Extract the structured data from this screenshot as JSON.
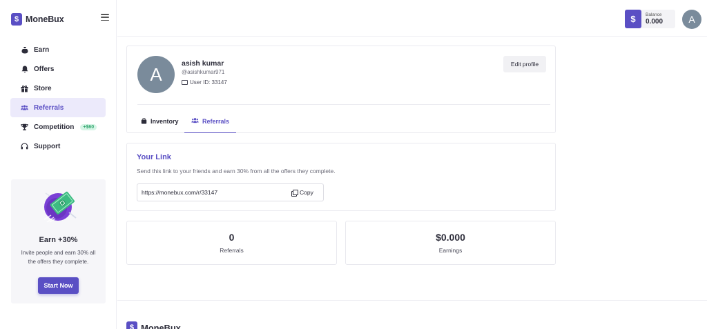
{
  "brand": {
    "name": "MoneBux",
    "logo_glyph": "$",
    "color": "#5a4fc4"
  },
  "sidebar": {
    "items": [
      {
        "label": "Earn",
        "icon": "money-bag-icon",
        "glyph": "💰",
        "active": false
      },
      {
        "label": "Offers",
        "icon": "bell-icon",
        "glyph": "🔔",
        "active": false
      },
      {
        "label": "Store",
        "icon": "gift-icon",
        "glyph": "🎁",
        "active": false
      },
      {
        "label": "Referrals",
        "icon": "users-icon",
        "glyph": "👥",
        "active": true
      },
      {
        "label": "Competition",
        "icon": "trophy-icon",
        "glyph": "🏆",
        "active": false,
        "badge": "+$60"
      },
      {
        "label": "Support",
        "icon": "headset-icon",
        "glyph": "🎧",
        "active": false
      }
    ],
    "promo": {
      "title": "Earn +30%",
      "text": "Invite people and earn 30% all the offers they complete.",
      "button": "Start Now"
    }
  },
  "header": {
    "balance_glyph": "$",
    "balance_label": "Balance",
    "balance_value": "0.000",
    "avatar_letter": "A"
  },
  "profile": {
    "avatar_letter": "A",
    "name": "asish kumar",
    "handle": "@asishkumar971",
    "user_id": "User ID: 33147",
    "edit_button": "Edit profile",
    "tabs": [
      {
        "label": "Inventory",
        "icon": "bag-icon",
        "glyph": "👜",
        "active": false
      },
      {
        "label": "Referrals",
        "icon": "users-icon",
        "glyph": "👥",
        "active": true
      }
    ]
  },
  "link": {
    "title": "Your Link",
    "description": "Send this link to your friends and earn 30% from all the offers they complete.",
    "url": "https://monebux.com/r/33147",
    "copy_label": "Copy"
  },
  "stats": [
    {
      "value": "0",
      "label": "Referrals"
    },
    {
      "value": "$0.000",
      "label": "Earnings"
    }
  ],
  "footer": {
    "brand_name": "MoneBux"
  }
}
